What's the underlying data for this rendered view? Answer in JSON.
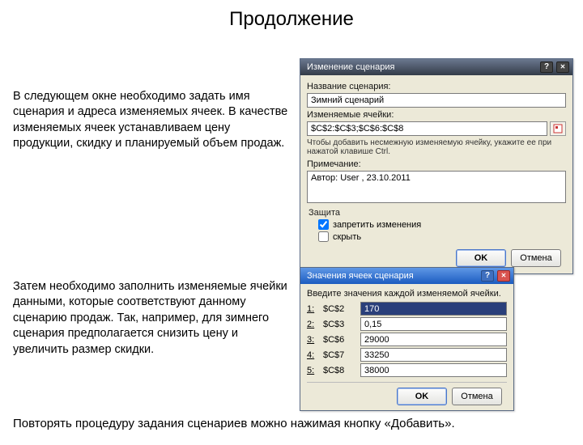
{
  "title": "Продолжение",
  "paragraph1": "В следующем окне необходимо задать имя сценария и адреса изменяемых ячеек. В качестве изменяемых ячеек устанавливаем цену продукции, скидку и планируемый объем продаж.",
  "paragraph2": "Затем необходимо заполнить изменяемые ячейки данными, которые соответствуют данному сценарию продаж. Так, например, для зимнего сценария предполагается снизить цену и увеличить размер скидки.",
  "paragraph3": "Повторять процедуру задания сценариев можно нажимая кнопку «Добавить».",
  "dlg1": {
    "title": "Изменение сценария",
    "name_label": "Название сценария:",
    "name_value": "Зимний сценарий",
    "cells_label": "Изменяемые ячейки:",
    "cells_value": "$C$2:$C$3;$C$6:$C$8",
    "cells_hint": "Чтобы добавить несмежную изменяемую ячейку, укажите ее при нажатой клавише Ctrl.",
    "note_label": "Примечание:",
    "note_value": "Автор: User , 23.10.2011",
    "group_label": "Защита",
    "chk_protect": "запретить изменения",
    "chk_hide": "скрыть",
    "ok": "OK",
    "cancel": "Отмена"
  },
  "dlg2": {
    "title": "Значения ячеек сценария",
    "instr": "Введите значения каждой изменяемой ячейки.",
    "rows": [
      {
        "n": "1:",
        "addr": "$C$2",
        "val": "170"
      },
      {
        "n": "2:",
        "addr": "$C$3",
        "val": "0,15"
      },
      {
        "n": "3:",
        "addr": "$C$6",
        "val": "29000"
      },
      {
        "n": "4:",
        "addr": "$C$7",
        "val": "33250"
      },
      {
        "n": "5:",
        "addr": "$C$8",
        "val": "38000"
      }
    ],
    "ok": "OK",
    "cancel": "Отмена"
  }
}
